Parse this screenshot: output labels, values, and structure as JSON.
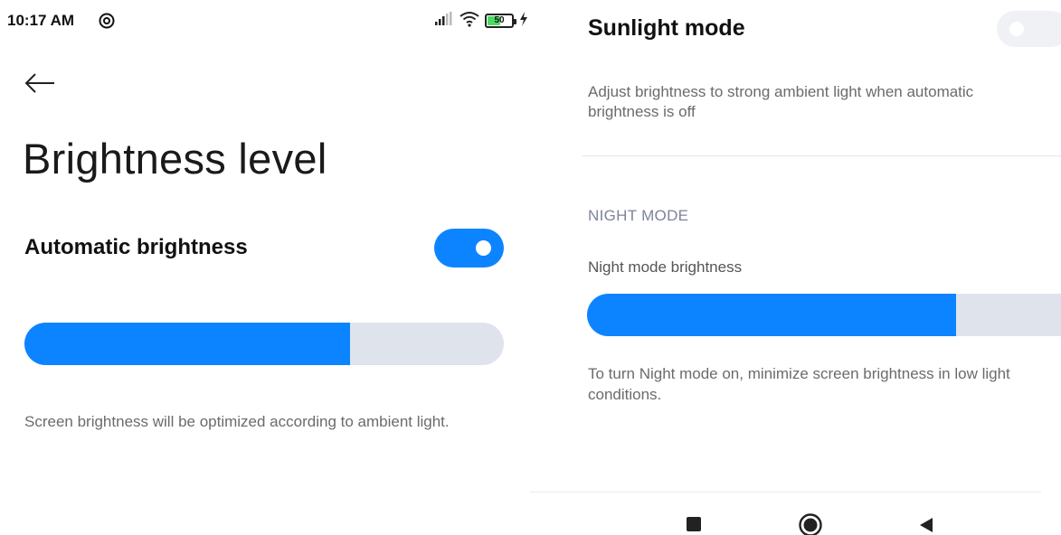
{
  "status_bar": {
    "time": "10:17 AM",
    "battery_level": "50",
    "icons": [
      "alarm-icon",
      "signal-icon",
      "wifi-icon",
      "battery-icon",
      "charging-icon"
    ]
  },
  "left": {
    "title": "Brightness level",
    "automatic_brightness": {
      "label": "Automatic brightness",
      "enabled": true
    },
    "brightness_slider": {
      "value_fraction": 0.68
    },
    "description": "Screen brightness will be optimized according to ambient light."
  },
  "right": {
    "sunlight_mode": {
      "label": "Sunlight mode",
      "enabled": false,
      "description": "Adjust brightness to strong ambient light when automatic brightness is off"
    },
    "night_mode": {
      "section_header": "NIGHT MODE",
      "brightness_label": "Night mode brightness",
      "slider_value_fraction": 0.77,
      "description": "To turn Night mode on, minimize screen brightness in low light conditions."
    }
  },
  "nav_bar": {
    "buttons": [
      "recent-apps",
      "home",
      "back"
    ]
  },
  "colors": {
    "accent": "#0d84ff",
    "track": "#dfe3ec",
    "secondary_text": "#6b6b6b",
    "section_header": "#7d849a"
  }
}
